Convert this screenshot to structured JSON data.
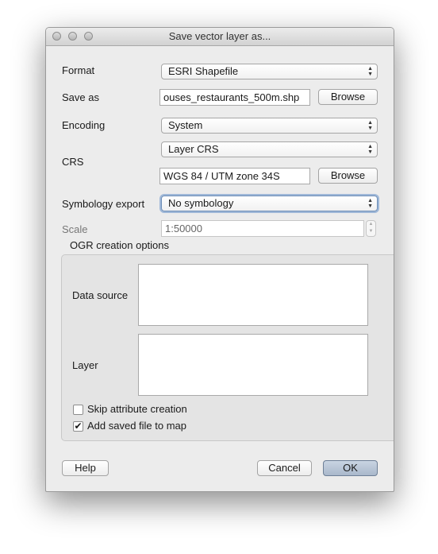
{
  "window": {
    "title": "Save vector layer as..."
  },
  "form": {
    "format_label": "Format",
    "format_value": "ESRI Shapefile",
    "save_as_label": "Save as",
    "save_as_value": "ouses_restaurants_500m.shp",
    "browse_label": "Browse",
    "encoding_label": "Encoding",
    "encoding_value": "System",
    "crs_label": "CRS",
    "crs_mode": "Layer CRS",
    "crs_value": "WGS 84 / UTM zone 34S",
    "crs_browse_label": "Browse",
    "symbology_label": "Symbology export",
    "symbology_value": "No symbology",
    "scale_label": "Scale",
    "scale_value": "1:50000"
  },
  "ogr": {
    "title": "OGR creation options",
    "data_source_label": "Data source",
    "layer_label": "Layer"
  },
  "options": {
    "skip_attr_label": "Skip attribute creation",
    "skip_attr_checked": false,
    "add_to_map_label": "Add saved file to map",
    "add_to_map_checked": true
  },
  "buttons": {
    "help": "Help",
    "cancel": "Cancel",
    "ok": "OK"
  }
}
